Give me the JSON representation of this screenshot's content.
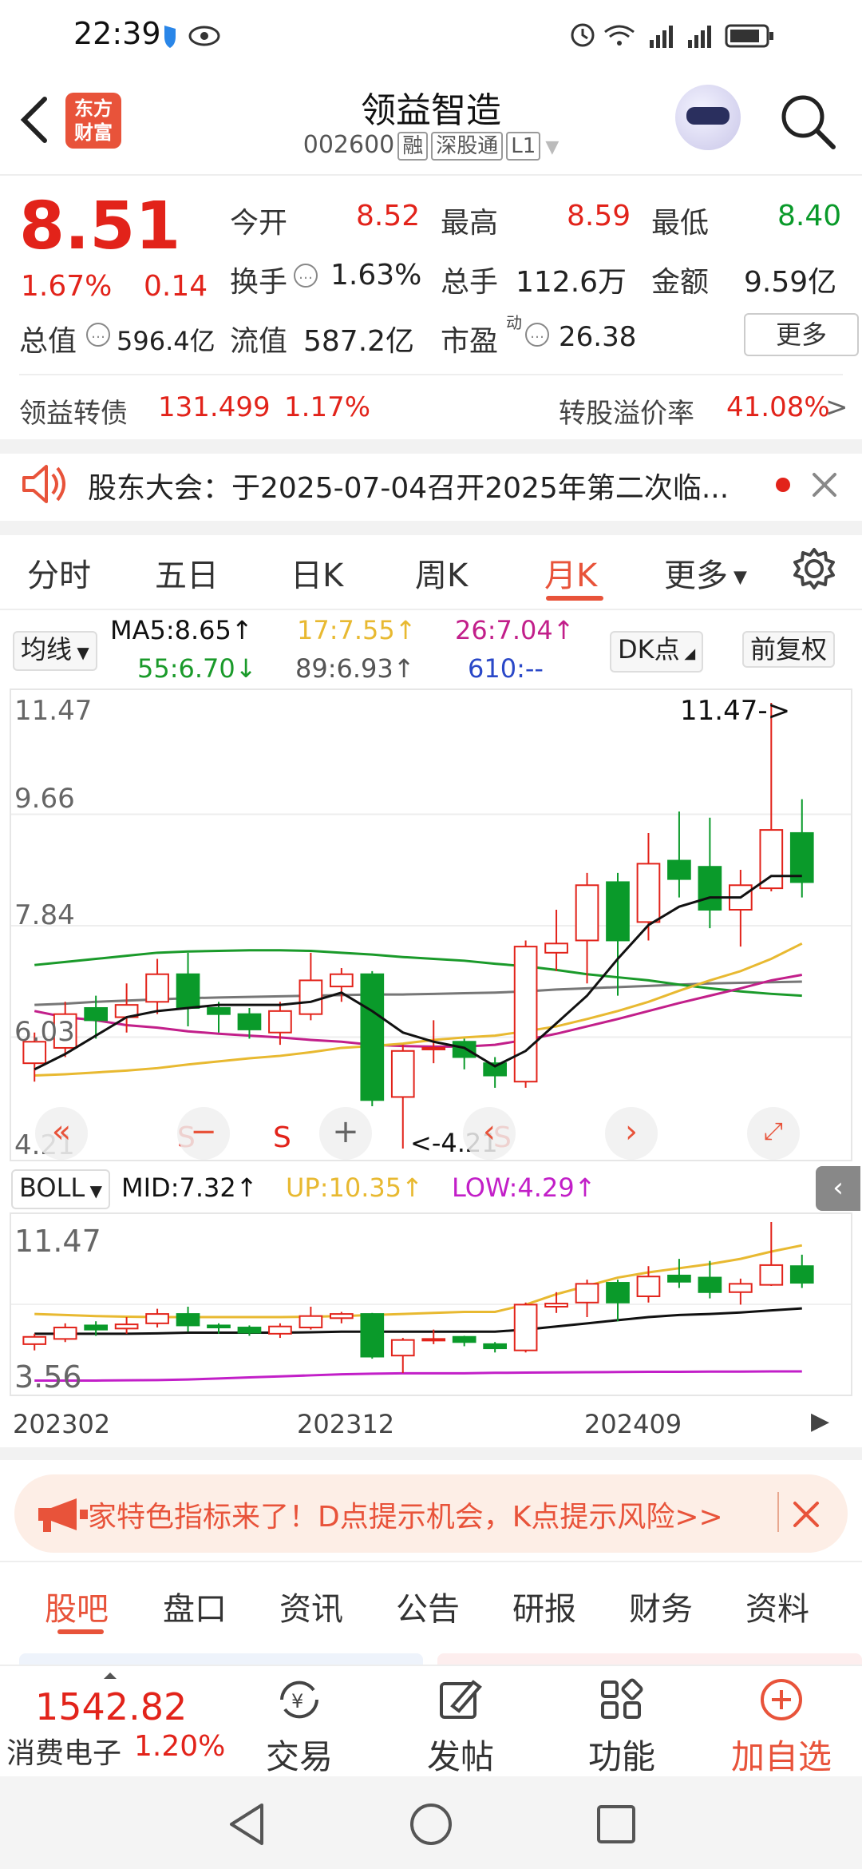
{
  "status": {
    "time": "22:39"
  },
  "header": {
    "logo_line1": "东方",
    "logo_line2": "财富",
    "title": "领益智造",
    "code": "002600",
    "tags": [
      "融",
      "深股通",
      "L1"
    ]
  },
  "quote": {
    "price": "8.51",
    "change_pct": "1.67%",
    "change": "0.14",
    "open_label": "今开",
    "open": "8.52",
    "high_label": "最高",
    "high": "8.59",
    "low_label": "最低",
    "low": "8.40",
    "turnover_label": "换手",
    "turnover": "1.63%",
    "volume_label": "总手",
    "volume": "112.6万",
    "amount_label": "金额",
    "amount": "9.59亿",
    "mcap_label": "总值",
    "mcap": "596.4亿",
    "float_label": "流值",
    "float": "587.2亿",
    "pe_label": "市盈",
    "pe_sup": "动",
    "pe": "26.38",
    "more_label": "更多"
  },
  "bond": {
    "name": "领益转债",
    "price": "131.499",
    "pct": "1.17%",
    "premium_label": "转股溢价率",
    "premium": "41.08%",
    "arrow": ">"
  },
  "notice": {
    "text": "股东大会：于2025-07-04召开2025年第二次临..."
  },
  "ktabs": [
    "分时",
    "五日",
    "日K",
    "周K",
    "月K",
    "更多"
  ],
  "ktab_active": 4,
  "ma": {
    "selector": "均线",
    "ma5": "MA5:8.65↑",
    "ma17": "17:7.55↑",
    "ma26": "26:7.04↑",
    "ma55": "55:6.70↓",
    "ma89": "89:6.93↑",
    "ma610": "610:--",
    "dk_label": "DK点",
    "adj_label": "前复权"
  },
  "colors": {
    "up": "#e2231a",
    "down": "#0a9a2a",
    "ma5": "#111111",
    "ma17": "#e8b931",
    "ma26": "#c21f8a",
    "ma55": "#1a9a2a",
    "ma89": "#777777",
    "ma610": "#2a48c8",
    "accent": "#e8533a"
  },
  "chart_main": {
    "y_ticks": [
      "11.47",
      "9.66",
      "7.84",
      "6.03",
      "4.21"
    ],
    "max_label": "11.47->",
    "min_label": "<-4.21",
    "signals": [
      "S",
      "S",
      "S"
    ]
  },
  "boll": {
    "selector": "BOLL",
    "mid": "MID:7.32↑",
    "up": "UP:10.35↑",
    "low": "LOW:4.29↑",
    "y_top": "11.47",
    "y_bottom": "3.56",
    "x_labels": [
      "202302",
      "202312",
      "202409"
    ]
  },
  "chart_data": [
    {
      "type": "candlestick",
      "title": "",
      "period": "monthly",
      "ylim": [
        4.21,
        11.47
      ],
      "candles": [
        {
          "o": 5.6,
          "c": 5.95,
          "h": 6.1,
          "l": 5.3
        },
        {
          "o": 5.85,
          "c": 6.4,
          "h": 6.6,
          "l": 5.7
        },
        {
          "o": 6.5,
          "c": 6.3,
          "h": 6.7,
          "l": 6.0
        },
        {
          "o": 6.35,
          "c": 6.55,
          "h": 6.9,
          "l": 6.1
        },
        {
          "o": 6.6,
          "c": 7.05,
          "h": 7.3,
          "l": 6.4
        },
        {
          "o": 7.05,
          "c": 6.5,
          "h": 7.4,
          "l": 6.2
        },
        {
          "o": 6.5,
          "c": 6.4,
          "h": 6.6,
          "l": 6.1
        },
        {
          "o": 6.4,
          "c": 6.15,
          "h": 6.5,
          "l": 6.0
        },
        {
          "o": 6.1,
          "c": 6.45,
          "h": 6.6,
          "l": 5.9
        },
        {
          "o": 6.4,
          "c": 6.95,
          "h": 7.4,
          "l": 6.3
        },
        {
          "o": 6.85,
          "c": 7.05,
          "h": 7.15,
          "l": 6.6
        },
        {
          "o": 7.05,
          "c": 5.0,
          "h": 7.1,
          "l": 4.9
        },
        {
          "o": 5.05,
          "c": 5.8,
          "h": 5.9,
          "l": 4.21
        },
        {
          "o": 5.85,
          "c": 5.85,
          "h": 6.3,
          "l": 5.6
        },
        {
          "o": 5.95,
          "c": 5.7,
          "h": 6.0,
          "l": 5.5
        },
        {
          "o": 5.6,
          "c": 5.4,
          "h": 5.7,
          "l": 5.2
        },
        {
          "o": 5.3,
          "c": 7.5,
          "h": 7.6,
          "l": 5.2
        },
        {
          "o": 7.4,
          "c": 7.55,
          "h": 8.1,
          "l": 7.1
        },
        {
          "o": 7.6,
          "c": 8.5,
          "h": 8.7,
          "l": 6.9
        },
        {
          "o": 8.55,
          "c": 7.6,
          "h": 8.7,
          "l": 6.7
        },
        {
          "o": 7.9,
          "c": 8.85,
          "h": 9.35,
          "l": 7.6
        },
        {
          "o": 8.9,
          "c": 8.6,
          "h": 9.7,
          "l": 8.3
        },
        {
          "o": 8.8,
          "c": 8.1,
          "h": 9.6,
          "l": 7.8
        },
        {
          "o": 8.1,
          "c": 8.5,
          "h": 8.75,
          "l": 7.5
        },
        {
          "o": 8.45,
          "c": 9.4,
          "h": 11.47,
          "l": 8.4
        },
        {
          "o": 9.35,
          "c": 8.55,
          "h": 9.9,
          "l": 8.3
        }
      ],
      "series": [
        {
          "name": "MA5",
          "values": [
            5.5,
            5.75,
            6.05,
            6.35,
            6.45,
            6.5,
            6.55,
            6.55,
            6.55,
            6.6,
            6.75,
            6.45,
            6.1,
            5.95,
            5.85,
            5.55,
            5.8,
            6.25,
            6.7,
            7.3,
            7.85,
            8.15,
            8.3,
            8.3,
            8.65,
            8.65
          ]
        },
        {
          "name": "17",
          "values": [
            5.4,
            5.42,
            5.45,
            5.48,
            5.52,
            5.58,
            5.63,
            5.68,
            5.72,
            5.78,
            5.85,
            5.88,
            5.92,
            5.98,
            6.02,
            6.05,
            6.12,
            6.2,
            6.32,
            6.45,
            6.6,
            6.78,
            6.95,
            7.1,
            7.3,
            7.55
          ]
        },
        {
          "name": "26",
          "values": [
            6.45,
            6.35,
            6.3,
            6.22,
            6.18,
            6.12,
            6.08,
            6.05,
            6.02,
            5.98,
            5.95,
            5.9,
            5.88,
            5.87,
            5.87,
            5.9,
            5.98,
            6.08,
            6.2,
            6.32,
            6.45,
            6.58,
            6.7,
            6.82,
            6.95,
            7.04
          ]
        },
        {
          "name": "55",
          "values": [
            7.2,
            7.25,
            7.3,
            7.35,
            7.4,
            7.42,
            7.43,
            7.44,
            7.44,
            7.43,
            7.4,
            7.37,
            7.33,
            7.3,
            7.27,
            7.22,
            7.18,
            7.12,
            7.05,
            7.0,
            6.95,
            6.88,
            6.82,
            6.77,
            6.73,
            6.7
          ]
        },
        {
          "name": "89",
          "values": [
            6.55,
            6.57,
            6.6,
            6.62,
            6.64,
            6.66,
            6.67,
            6.68,
            6.69,
            6.7,
            6.71,
            6.72,
            6.72,
            6.73,
            6.74,
            6.75,
            6.77,
            6.8,
            6.82,
            6.84,
            6.86,
            6.88,
            6.9,
            6.91,
            6.92,
            6.93
          ]
        }
      ]
    },
    {
      "type": "candlestick",
      "title": "",
      "indicator": "BOLL",
      "ylim": [
        3.56,
        11.47
      ],
      "x_labels": [
        "202302",
        "202312",
        "202409"
      ],
      "series": [
        {
          "name": "MID",
          "values": [
            6.1,
            6.1,
            6.1,
            6.1,
            6.12,
            6.15,
            6.15,
            6.15,
            6.15,
            6.17,
            6.2,
            6.2,
            6.2,
            6.2,
            6.2,
            6.2,
            6.3,
            6.45,
            6.6,
            6.75,
            6.9,
            7.0,
            7.05,
            7.12,
            7.22,
            7.32
          ]
        },
        {
          "name": "UP",
          "values": [
            7.05,
            7.0,
            6.95,
            6.92,
            6.9,
            6.9,
            6.9,
            6.9,
            6.9,
            6.92,
            6.95,
            7.0,
            7.05,
            7.1,
            7.15,
            7.15,
            7.5,
            8.0,
            8.4,
            8.8,
            9.05,
            9.25,
            9.45,
            9.7,
            10.05,
            10.35
          ]
        },
        {
          "name": "LOW",
          "values": [
            3.85,
            3.85,
            3.85,
            3.86,
            3.87,
            3.9,
            3.95,
            4.0,
            4.05,
            4.1,
            4.15,
            4.18,
            4.2,
            4.2,
            4.2,
            4.22,
            4.23,
            4.24,
            4.25,
            4.26,
            4.27,
            4.27,
            4.28,
            4.28,
            4.29,
            4.29
          ]
        }
      ]
    }
  ],
  "banner": {
    "text": "家特色指标来了！D点提示机会，K点提示风险>>"
  },
  "btabs": [
    "股吧",
    "盘口",
    "资讯",
    "公告",
    "研报",
    "财务",
    "资料"
  ],
  "btab_active": 0,
  "bottombar": {
    "index_value": "1542.82",
    "index_name": "消费电子",
    "index_pct": "1.20%",
    "trade_label": "交易",
    "post_label": "发帖",
    "func_label": "功能",
    "add_label": "加自选"
  }
}
